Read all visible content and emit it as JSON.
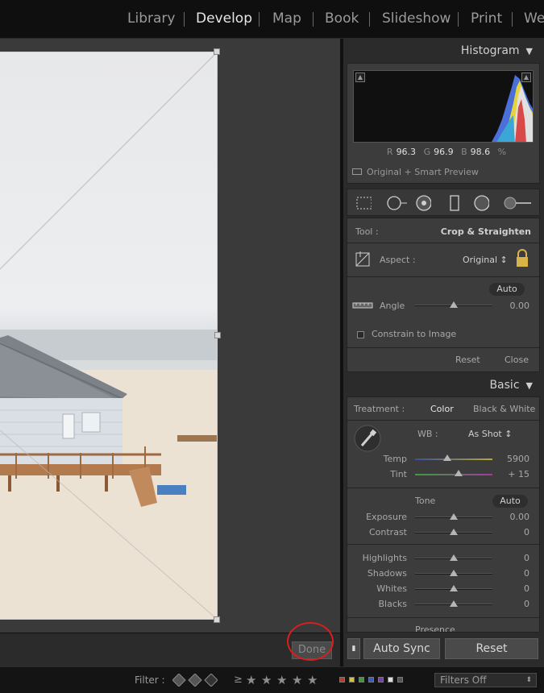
{
  "modules": [
    {
      "label": "Library",
      "active": false
    },
    {
      "label": "Develop",
      "active": true
    },
    {
      "label": "Map",
      "active": false
    },
    {
      "label": "Book",
      "active": false
    },
    {
      "label": "Slideshow",
      "active": false
    },
    {
      "label": "Print",
      "active": false
    },
    {
      "label": "We",
      "active": false
    }
  ],
  "histogram": {
    "title": "Histogram",
    "r_label": "R",
    "r_value": "96.3",
    "g_label": "G",
    "g_value": "96.9",
    "b_label": "B",
    "b_value": "98.6",
    "unit": "%",
    "preview_label": "Original + Smart Preview"
  },
  "crop": {
    "tool_label": "Tool :",
    "tool_name": "Crop & Straighten",
    "aspect_label": "Aspect :",
    "aspect_value": "Original ↕",
    "auto_label": "Auto",
    "angle_label": "Angle",
    "angle_value": "0.00",
    "angle_position": 0.5,
    "constrain_label": "Constrain to Image",
    "reset_label": "Reset",
    "close_label": "Close"
  },
  "basic": {
    "title": "Basic",
    "treatment_label": "Treatment :",
    "color_label": "Color",
    "bw_label": "Black & White",
    "wb_label": "WB :",
    "wb_value": "As Shot ↕",
    "temp_label": "Temp",
    "temp_value": "5900",
    "temp_position": 0.42,
    "tint_label": "Tint",
    "tint_value": "+ 15",
    "tint_position": 0.56,
    "tone_label": "Tone",
    "tone_auto": "Auto",
    "exposure_label": "Exposure",
    "exposure_value": "0.00",
    "contrast_label": "Contrast",
    "contrast_value": "0",
    "highlights_label": "Highlights",
    "highlights_value": "0",
    "shadows_label": "Shadows",
    "shadows_value": "0",
    "whites_label": "Whites",
    "whites_value": "0",
    "blacks_label": "Blacks",
    "blacks_value": "0",
    "presence_label": "Presence"
  },
  "bottom": {
    "done_label": "Done",
    "auto_sync_label": "Auto Sync",
    "reset_label": "Reset"
  },
  "filter": {
    "label": "Filter :",
    "gte": "≥",
    "stars": "★",
    "filters_value": "Filters Off",
    "swatch_colors": [
      "#c0392b",
      "#d4c23a",
      "#3c9a3c",
      "#3b5bc4",
      "#7b3fb0",
      "#e0e0e0",
      "#555555"
    ]
  },
  "colors": {
    "accent_annotation": "#d81f1f"
  }
}
